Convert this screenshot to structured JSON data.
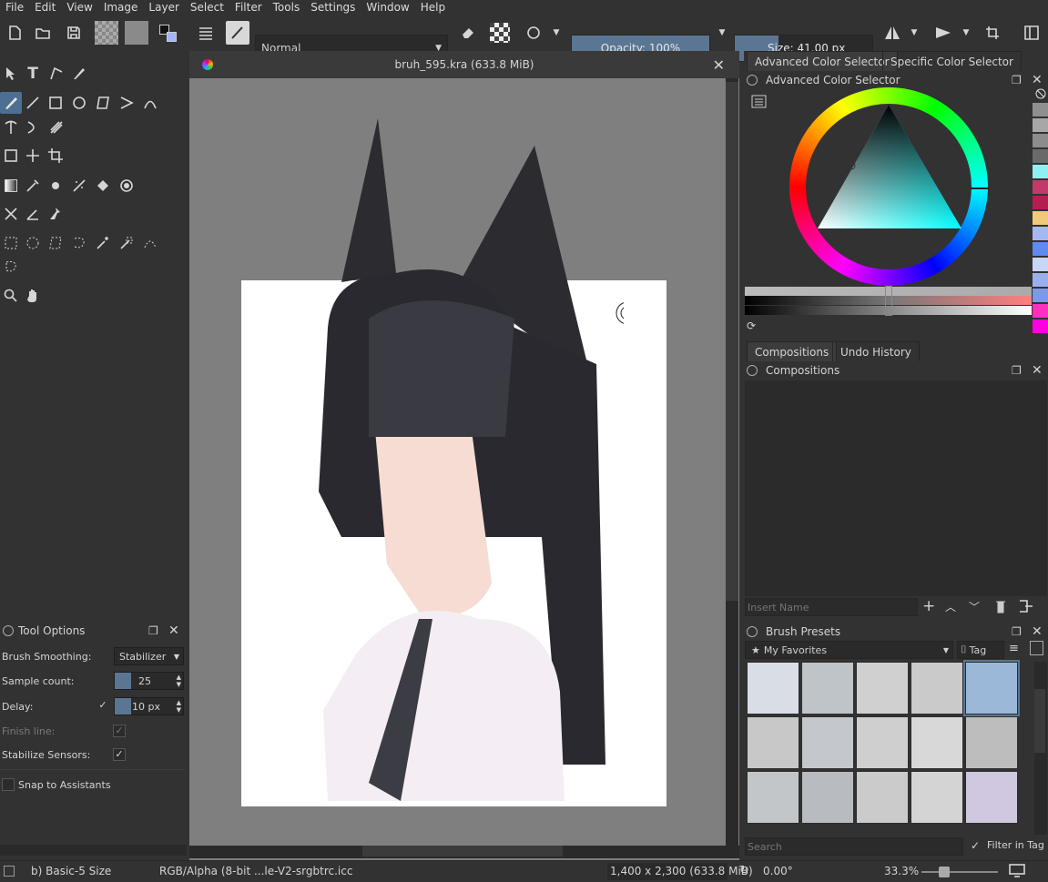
{
  "menu": [
    "File",
    "Edit",
    "View",
    "Image",
    "Layer",
    "Select",
    "Filter",
    "Tools",
    "Settings",
    "Window",
    "Help"
  ],
  "toolbar": {
    "blend_mode": "Normal",
    "opacity": "Opacity: 100%",
    "size": "Size: 41.00 px"
  },
  "document": {
    "tab_title": "bruh_595.kra (633.8 MiB)"
  },
  "tool_options": {
    "title": "Tool Options",
    "brush_smoothing_label": "Brush Smoothing:",
    "brush_smoothing_value": "Stabilizer",
    "sample_count_label": "Sample count:",
    "sample_count_value": "25",
    "delay_label": "Delay:",
    "delay_value": "10 px",
    "finish_line_label": "Finish line:",
    "stabilize_sensors_label": "Stabilize Sensors:",
    "snap_label": "Snap to Assistants"
  },
  "color_panel": {
    "tabs": [
      "Advanced Color Selector",
      "Specific Color Selector"
    ],
    "title": "Advanced Color Selector",
    "swatches": [
      "#8f8f8f",
      "#a7a7a7",
      "#8c8c8c",
      "#6a6a6a",
      "#8ef0f0",
      "#c23a6a",
      "#b51f4f",
      "#f0c97a",
      "#a6b8f0",
      "#5f8af0",
      "#c8d6f8",
      "#9ab0ee",
      "#7a9ae8",
      "#ff2fc0",
      "#ff00e0"
    ]
  },
  "compositions_panel": {
    "tabs": [
      "Compositions",
      "Undo History"
    ],
    "title": "Compositions",
    "name_placeholder": "Insert Name"
  },
  "brush_presets": {
    "title": "Brush Presets",
    "favorites": "My Favorites",
    "tag": "Tag",
    "search_placeholder": "Search",
    "filter_label": "Filter in Tag"
  },
  "status": {
    "brush": "b) Basic-5 Size",
    "color_space": "RGB/Alpha (8-bit ...le-V2-srgbtrc.icc",
    "dimensions": "1,400 x 2,300 (633.8 MiB)",
    "rotation": "0.00°",
    "zoom": "33.3%"
  }
}
